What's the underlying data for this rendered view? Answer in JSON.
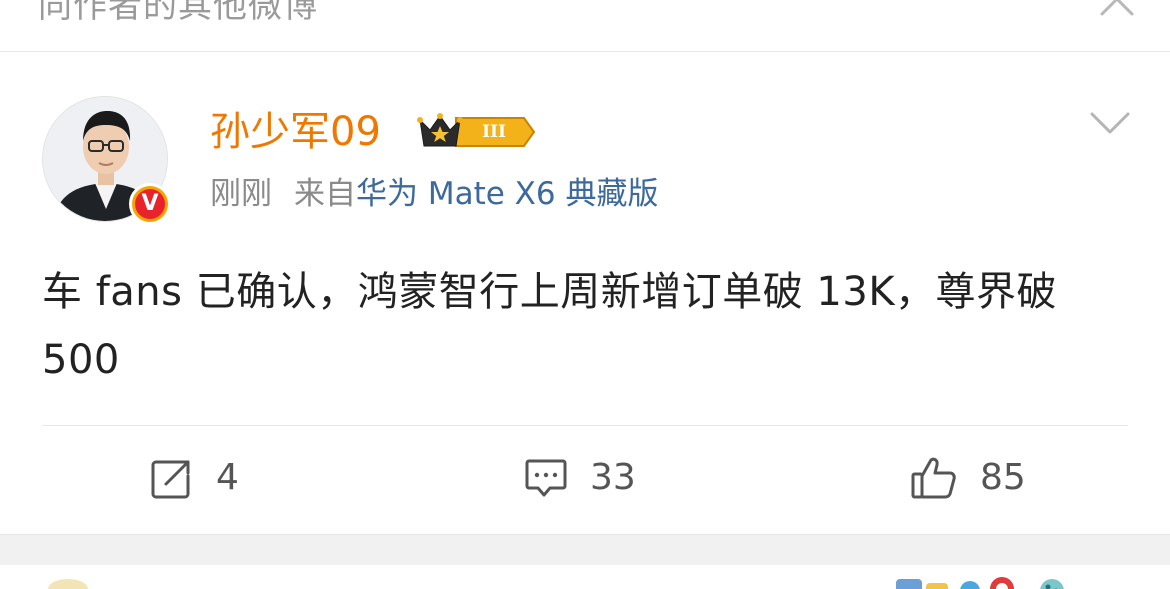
{
  "top_bar": {
    "title": "同作者的其他微博"
  },
  "post": {
    "author": {
      "name": "孙少军09",
      "vip_level": "III"
    },
    "meta": {
      "time": "刚刚",
      "source_prefix": "来自",
      "source": "华为 Mate X6 典藏版"
    },
    "text": "车 fans 已确认，鸿蒙智行上周新增订单破 13K，尊界破 500",
    "actions": {
      "repost_count": "4",
      "comment_count": "33",
      "like_count": "85"
    }
  },
  "colors": {
    "username": "#f07800",
    "source_link": "#3d6a9c",
    "verified_badge": "#f7a400",
    "vip_badge": "#f3b21a"
  },
  "icons": {
    "close": "close-icon",
    "more": "chevron-down-icon",
    "verified": "verified-v-icon",
    "vip": "crown-vip-icon",
    "repost": "repost-icon",
    "comment": "comment-icon",
    "like": "like-icon"
  }
}
